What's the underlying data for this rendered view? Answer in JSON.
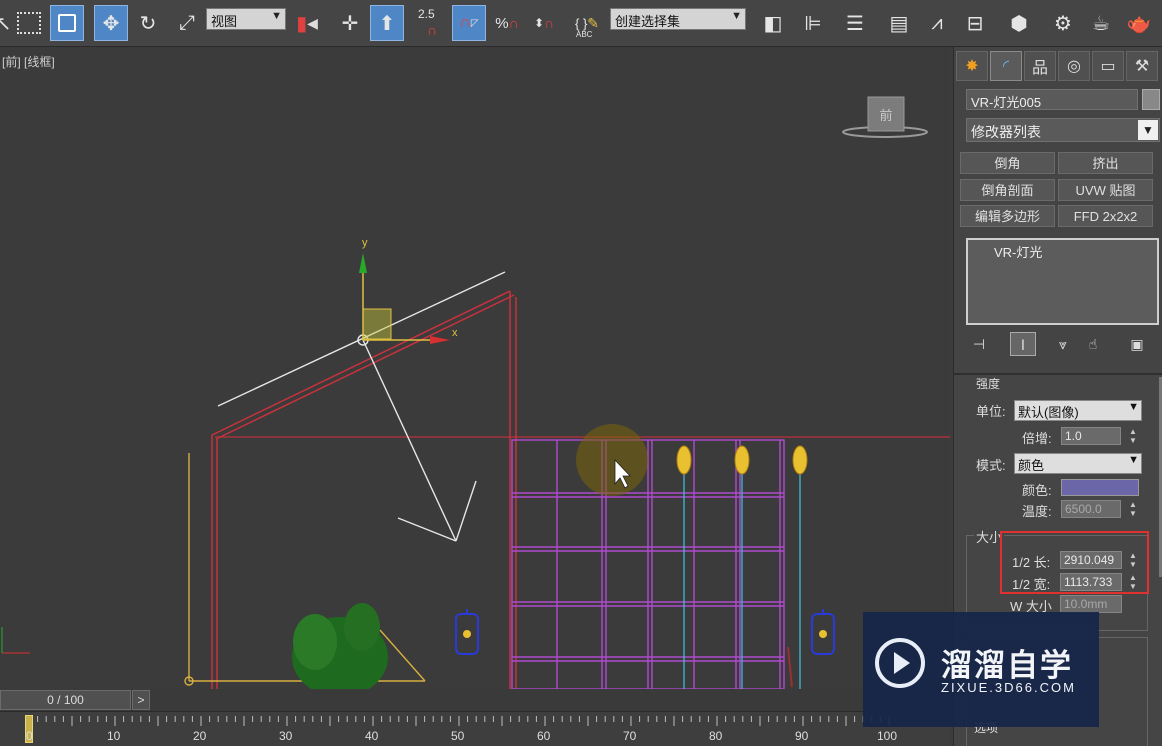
{
  "toolbar": {
    "view_combo": "视图",
    "snap_angle_label": "2.5",
    "percent_snap_label": "%",
    "selection_set_combo": "创建选择集",
    "edit_named_label": "{ }",
    "abc_label": "ABC"
  },
  "viewport": {
    "label_view": "[前]",
    "label_mode": "[线框]",
    "viewcube_face": "前",
    "axis_x": "x",
    "axis_y": "y"
  },
  "panel": {
    "object_name": "VR-灯光005",
    "modifier_list": "修改器列表",
    "modifier_buttons": [
      "倒角",
      "挤出",
      "倒角剖面",
      "UVW 贴图",
      "编辑多边形",
      "FFD 2x2x2"
    ],
    "stack_item": "VR-灯光",
    "rollout_partial_title": "强度",
    "unit_label": "单位:",
    "unit_value": "默认(图像)",
    "multiplier_label": "倍增:",
    "multiplier_value": "1.0",
    "mode_label": "模式:",
    "mode_value": "颜色",
    "color_label": "颜色:",
    "color_value": "#6b66a8",
    "temperature_label": "温度:",
    "temperature_value": "6500.0",
    "size_group_title": "大小",
    "half_length_label": "1/2 长:",
    "half_length_value": "2910.049",
    "half_width_label": "1/2 宽:",
    "half_width_value": "1113.733",
    "w_size_label": "W 大小",
    "w_size_value": "10.0mm",
    "bottom_partial_label": "选项"
  },
  "timeline": {
    "frame_display": "0 / 100",
    "next_button": ">",
    "ticks": [
      "0",
      "10",
      "20",
      "30",
      "40",
      "50",
      "60",
      "70",
      "80",
      "90",
      "100"
    ]
  },
  "watermark": {
    "title": "溜溜自学",
    "url": "ZIXUE.3D66.COM"
  },
  "colors": {
    "accent": "#4f86c6",
    "highlight_box": "#e03030",
    "wireframe_red": "#c8323c",
    "wireframe_magenta": "#b04ad0",
    "light_gizmo": "#e6e6e6",
    "gizmo_yellow": "#e0c040"
  },
  "icons": [
    "select-arrow-icon",
    "rect-select-icon",
    "window-crossing-icon",
    "move-icon",
    "rotate-icon",
    "scale-icon",
    "mirror-icon",
    "align-icon",
    "layer-icon",
    "render-setup-icon",
    "render-frame-icon",
    "render-icon",
    "teapot-icon"
  ]
}
